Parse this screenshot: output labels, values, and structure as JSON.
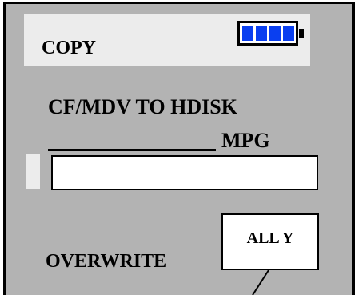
{
  "header": {
    "title": "COPY",
    "battery": {
      "icon": "battery-icon",
      "bars_filled": 4,
      "bars_total": 4,
      "bar_color": "#0a3ff0"
    }
  },
  "copy": {
    "mode": "CF/MDV TO HDISK",
    "filename_value": "",
    "extension": "MPG"
  },
  "overwrite": {
    "label": "OVERWRITE",
    "value": "ALL Y"
  },
  "colors": {
    "screen_bg": "#b3b3b3",
    "title_bar_bg": "#ececec",
    "field_bg": "#ffffff",
    "text": "#000000"
  }
}
